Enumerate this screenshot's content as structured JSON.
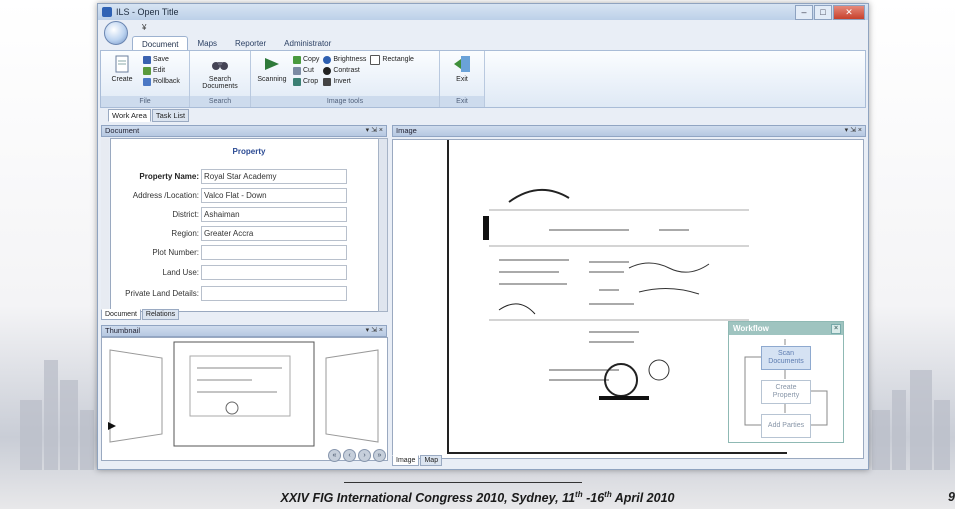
{
  "window": {
    "title": "ILS - Open Title",
    "qat_label": "¥"
  },
  "ribbon": {
    "tabs": [
      "Document",
      "Maps",
      "Reporter",
      "Administrator"
    ],
    "groups": {
      "file": {
        "label": "File",
        "create": "Create",
        "save": "Save",
        "edit": "Edit",
        "rollback": "Rollback"
      },
      "search": {
        "label": "Search",
        "search_documents": "Search Documents"
      },
      "image_tools": {
        "label": "Image tools",
        "scanning": "Scanning",
        "copy": "Copy",
        "cut": "Cut",
        "crop": "Crop",
        "brightness": "Brightness",
        "contrast": "Contrast",
        "invert": "Invert",
        "rectangle": "Rectangle"
      },
      "exit": {
        "label": "Exit",
        "exit": "Exit"
      }
    }
  },
  "work_tabs": [
    "Work Area",
    "Task List"
  ],
  "document_panel": {
    "header": "Document",
    "ctrls": "▾ ⇲ ×",
    "title": "Property",
    "fields": [
      {
        "label": "Property Name:",
        "value": "Royal Star Academy"
      },
      {
        "label": "Address /Location:",
        "value": "Valco Flat - Down"
      },
      {
        "label": "District:",
        "value": "Ashaiman"
      },
      {
        "label": "Region:",
        "value": "Greater Accra"
      },
      {
        "label": "Plot Number:",
        "value": ""
      },
      {
        "label": "Land Use:",
        "value": ""
      },
      {
        "label": "Private Land Details:",
        "value": ""
      }
    ],
    "bottom_tabs": [
      "Document",
      "Relations"
    ]
  },
  "thumbnail_panel": {
    "header": "Thumbnail",
    "ctrls": "▾ ⇲ ×"
  },
  "image_panel": {
    "header": "Image",
    "ctrls": "▾ ⇲ ×",
    "bottom_tabs": [
      "Image",
      "Map"
    ]
  },
  "workflow": {
    "title": "Workflow",
    "steps": [
      "Scan Documents",
      "Create Property",
      "Add Parties"
    ]
  },
  "footer": {
    "text": "XXIV FIG International Congress 2010, Sydney, 11",
    "sup1": "th",
    "mid": " -16",
    "sup2": "th",
    "end": " April 2010",
    "slide_number": "9"
  },
  "colors": {
    "accent": "#2b4a93",
    "ribbon_bg": "#dfe9f5",
    "workflow_header": "#9fc4c0"
  }
}
